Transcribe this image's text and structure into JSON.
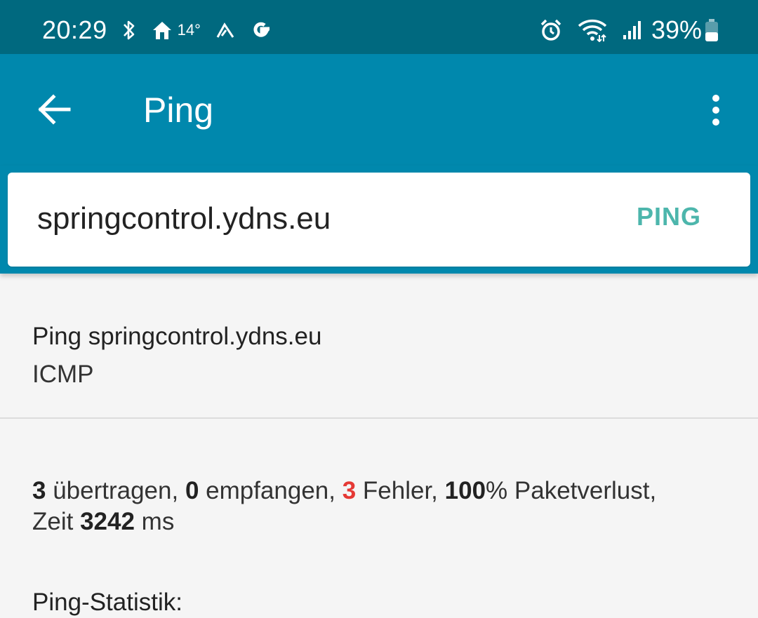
{
  "status_bar": {
    "time": "20:29",
    "temperature": "14°",
    "battery": "39%",
    "icons": [
      "bluetooth-icon",
      "home-icon",
      "weather-icon",
      "google-icon",
      "alarm-icon",
      "wifi-icon",
      "signal-icon",
      "battery-icon"
    ]
  },
  "app_bar": {
    "title": "Ping",
    "background": "#0088ad"
  },
  "search": {
    "host_value": "springcontrol.ydns.eu",
    "action_label": "PING",
    "action_color": "#4db6ac"
  },
  "results": {
    "header_title": "Ping springcontrol.ydns.eu",
    "protocol": "ICMP",
    "stats_title": "Ping-Statistik:",
    "transmitted": "3",
    "transmitted_label": " übertragen, ",
    "received": "0",
    "received_label": " empfangen, ",
    "errors": "3",
    "errors_label": " Fehler, ",
    "loss": "100",
    "loss_label": "% Paketverlust,",
    "time_label": "Zeit ",
    "time_value": "3242",
    "time_unit": " ms",
    "error_color": "#e53935"
  }
}
